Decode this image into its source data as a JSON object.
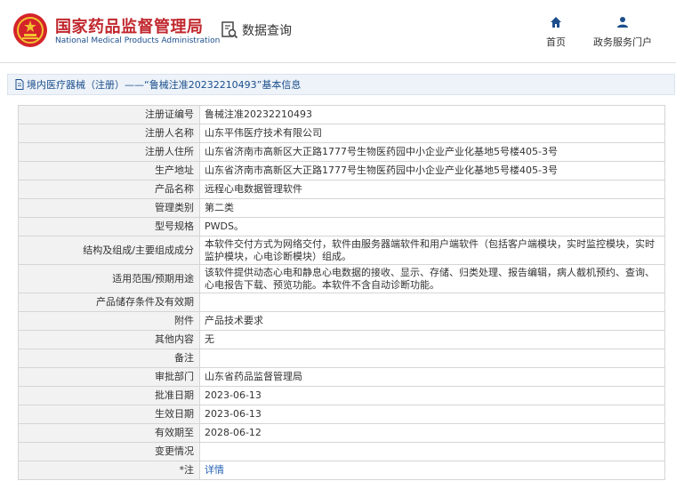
{
  "header": {
    "brand_cn": "国家药品监督管理局",
    "brand_en": "National Medical Products Administration",
    "query_label": "数据查询",
    "nav": {
      "home_label": "首页",
      "gov_service_label": "政务服务门户"
    },
    "colors": {
      "brand_red": "#c0272d",
      "brand_blue": "#1c4e8c"
    }
  },
  "section": {
    "title": "境内医疗器械（注册）——“鲁械注准20232210493”基本信息"
  },
  "fields": [
    {
      "label": "注册证编号",
      "value": "鲁械注准20232210493"
    },
    {
      "label": "注册人名称",
      "value": "山东平伟医疗技术有限公司"
    },
    {
      "label": "注册人住所",
      "value": "山东省济南市高新区大正路1777号生物医药园中小企业产业化基地5号楼405-3号"
    },
    {
      "label": "生产地址",
      "value": "山东省济南市高新区大正路1777号生物医药园中小企业产业化基地5号楼405-3号"
    },
    {
      "label": "产品名称",
      "value": "远程心电数据管理软件"
    },
    {
      "label": "管理类别",
      "value": "第二类"
    },
    {
      "label": "型号规格",
      "value": "PWDS。"
    },
    {
      "label": "结构及组成/主要组成成分",
      "value": "本软件交付方式为网络交付，软件由服务器端软件和用户端软件（包括客户端模块，实时监控模块，实时监护模块，心电诊断模块）组成。"
    },
    {
      "label": "适用范围/预期用途",
      "value": "该软件提供动态心电和静息心电数据的接收、显示、存储、归类处理、报告编辑，病人截机预约、查询、心电报告下载、预览功能。本软件不含自动诊断功能。"
    },
    {
      "label": "产品储存条件及有效期",
      "value": ""
    },
    {
      "label": "附件",
      "value": "产品技术要求"
    },
    {
      "label": "其他内容",
      "value": "无"
    },
    {
      "label": "备注",
      "value": ""
    },
    {
      "label": "审批部门",
      "value": "山东省药品监督管理局"
    },
    {
      "label": "批准日期",
      "value": "2023-06-13"
    },
    {
      "label": "生效日期",
      "value": "2023-06-13"
    },
    {
      "label": "有效期至",
      "value": "2028-06-12"
    },
    {
      "label": "变更情况",
      "value": ""
    },
    {
      "label": "",
      "note_prefix": "*",
      "note_label": "注",
      "value": "详情"
    }
  ]
}
